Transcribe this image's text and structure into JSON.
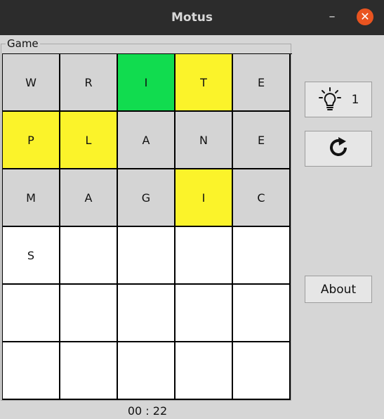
{
  "window": {
    "title": "Motus",
    "minimize_label": "–",
    "close_label": "✕"
  },
  "game": {
    "group_label": "Game",
    "timer": "00 : 22",
    "grid": [
      [
        {
          "letter": "W",
          "state": "used"
        },
        {
          "letter": "R",
          "state": "used"
        },
        {
          "letter": "I",
          "state": "green"
        },
        {
          "letter": "T",
          "state": "yellow"
        },
        {
          "letter": "E",
          "state": "used"
        }
      ],
      [
        {
          "letter": "P",
          "state": "yellow"
        },
        {
          "letter": "L",
          "state": "yellow"
        },
        {
          "letter": "A",
          "state": "used"
        },
        {
          "letter": "N",
          "state": "used"
        },
        {
          "letter": "E",
          "state": "used"
        }
      ],
      [
        {
          "letter": "M",
          "state": "used"
        },
        {
          "letter": "A",
          "state": "used"
        },
        {
          "letter": "G",
          "state": "used"
        },
        {
          "letter": "I",
          "state": "yellow"
        },
        {
          "letter": "C",
          "state": "used"
        }
      ],
      [
        {
          "letter": "S",
          "state": "empty"
        },
        {
          "letter": "",
          "state": "empty"
        },
        {
          "letter": "",
          "state": "empty"
        },
        {
          "letter": "",
          "state": "empty"
        },
        {
          "letter": "",
          "state": "empty"
        }
      ],
      [
        {
          "letter": "",
          "state": "empty"
        },
        {
          "letter": "",
          "state": "empty"
        },
        {
          "letter": "",
          "state": "empty"
        },
        {
          "letter": "",
          "state": "empty"
        },
        {
          "letter": "",
          "state": "empty"
        }
      ],
      [
        {
          "letter": "",
          "state": "empty"
        },
        {
          "letter": "",
          "state": "empty"
        },
        {
          "letter": "",
          "state": "empty"
        },
        {
          "letter": "",
          "state": "empty"
        },
        {
          "letter": "",
          "state": "empty"
        }
      ]
    ]
  },
  "side": {
    "hint_icon": "lightbulb-icon",
    "hint_count": "1",
    "reset_icon": "refresh-icon",
    "about_label": "About"
  },
  "colors": {
    "correct": "#11dc4f",
    "misplaced": "#fbf32a",
    "used": "#d4d4d4",
    "empty": "#ffffff",
    "close_button": "#e95420"
  }
}
